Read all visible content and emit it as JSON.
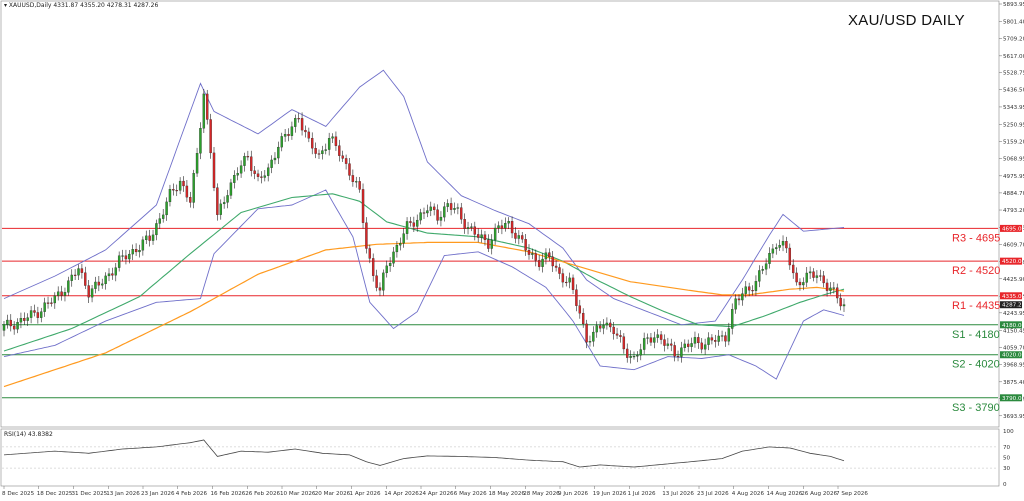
{
  "header": {
    "symbol_line": "XAUUSD,Daily  4331.87 4355.20 4278.31 4287.26",
    "title": "XAU/USD DAILY",
    "rsi_label": "RSI(14) 43.8382"
  },
  "colors": {
    "candle_up": "#2ca02c",
    "candle_down": "#d62728",
    "wick": "#222222",
    "bollinger": "#6f6fc9",
    "ma_green": "#3fa96b",
    "ma_orange": "#ff9a1f",
    "resistance": "#e8262b",
    "support": "#2b8a3e",
    "rsi_line": "#444444"
  },
  "chart_data": {
    "type": "candlestick",
    "title": "XAU/USD DAILY",
    "ylim": [
      3650,
      5893.95
    ],
    "y_ticks": [
      "5893.95",
      "5801.40",
      "5709.20",
      "5617.00",
      "5528.75",
      "5436.50",
      "5343.95",
      "5250.95",
      "5159.20",
      "5068.95",
      "4975.95",
      "4884.70",
      "4793.20",
      "4700.65",
      "4609.70",
      "4516.60",
      "4425.90",
      "4333.05",
      "4243.95",
      "4150.45",
      "4059.70",
      "3968.95",
      "3875.40",
      "3786.20",
      "3693.95"
    ],
    "x_ticks": [
      "8 Dec 2025",
      "18 Dec 2025",
      "31 Dec 2025",
      "13 Jan 2026",
      "23 Jan 2026",
      "4 Feb 2026",
      "16 Feb 2026",
      "26 Feb 2026",
      "10 Mar 2026",
      "20 Mar 2026",
      "1 Apr 2026",
      "14 Apr 2026",
      "24 Apr 2026",
      "6 May 2026",
      "18 May 2026",
      "28 May 2026",
      "9 Jun 2026",
      "19 Jun 2026",
      "1 Jul 2026",
      "13 Jul 2026",
      "23 Jul 2026",
      "4 Aug 2026",
      "14 Aug 2026",
      "26 Aug 2026",
      "7 Sep 2026"
    ],
    "current_price": "4287.26",
    "price_tags": [
      "4695.00",
      "4520.00",
      "4335.00",
      "4180.00",
      "4020.00",
      "3790.00"
    ],
    "levels": [
      {
        "label": "R3 - 4695",
        "value": 4695,
        "kind": "resistance"
      },
      {
        "label": "R2 - 4520",
        "value": 4520,
        "kind": "resistance"
      },
      {
        "label": "R1 - 4435",
        "value": 4335,
        "kind": "resistance"
      },
      {
        "label": "S1 - 4180",
        "value": 4180,
        "kind": "support"
      },
      {
        "label": "S2 - 4020",
        "value": 4020,
        "kind": "support"
      },
      {
        "label": "S3 - 3790",
        "value": 3790,
        "kind": "support"
      }
    ],
    "close_path": [
      [
        0,
        4170
      ],
      [
        5,
        4200
      ],
      [
        10,
        4250
      ],
      [
        15,
        4320
      ],
      [
        19,
        4400
      ],
      [
        22,
        4480
      ],
      [
        25,
        4360
      ],
      [
        28,
        4390
      ],
      [
        31,
        4450
      ],
      [
        34,
        4520
      ],
      [
        37,
        4560
      ],
      [
        40,
        4600
      ],
      [
        43,
        4640
      ],
      [
        46,
        4750
      ],
      [
        49,
        4870
      ],
      [
        52,
        4950
      ],
      [
        55,
        4840
      ],
      [
        57,
        5080
      ],
      [
        59,
        5430
      ],
      [
        61,
        5100
      ],
      [
        63,
        4750
      ],
      [
        66,
        4900
      ],
      [
        69,
        5000
      ],
      [
        72,
        5080
      ],
      [
        75,
        4950
      ],
      [
        78,
        5000
      ],
      [
        81,
        5150
      ],
      [
        84,
        5200
      ],
      [
        87,
        5300
      ],
      [
        90,
        5150
      ],
      [
        93,
        5080
      ],
      [
        96,
        5180
      ],
      [
        99,
        5100
      ],
      [
        102,
        5000
      ],
      [
        105,
        4880
      ],
      [
        107,
        4600
      ],
      [
        109,
        4450
      ],
      [
        111,
        4350
      ],
      [
        113,
        4500
      ],
      [
        116,
        4600
      ],
      [
        119,
        4700
      ],
      [
        122,
        4750
      ],
      [
        125,
        4800
      ],
      [
        128,
        4760
      ],
      [
        131,
        4820
      ],
      [
        134,
        4780
      ],
      [
        137,
        4700
      ],
      [
        140,
        4650
      ],
      [
        143,
        4620
      ],
      [
        146,
        4700
      ],
      [
        149,
        4720
      ],
      [
        152,
        4640
      ],
      [
        155,
        4560
      ],
      [
        158,
        4520
      ],
      [
        161,
        4540
      ],
      [
        164,
        4450
      ],
      [
        167,
        4400
      ],
      [
        170,
        4250
      ],
      [
        172,
        4100
      ],
      [
        174,
        4120
      ],
      [
        177,
        4200
      ],
      [
        180,
        4150
      ],
      [
        183,
        4050
      ],
      [
        186,
        4000
      ],
      [
        189,
        4080
      ],
      [
        192,
        4130
      ],
      [
        195,
        4080
      ],
      [
        198,
        4030
      ],
      [
        201,
        4060
      ],
      [
        204,
        4090
      ],
      [
        207,
        4080
      ],
      [
        210,
        4100
      ],
      [
        213,
        4120
      ],
      [
        216,
        4300
      ],
      [
        219,
        4370
      ],
      [
        222,
        4400
      ],
      [
        225,
        4520
      ],
      [
        228,
        4620
      ],
      [
        231,
        4580
      ],
      [
        234,
        4400
      ],
      [
        237,
        4430
      ],
      [
        240,
        4460
      ],
      [
        243,
        4380
      ],
      [
        246,
        4330
      ],
      [
        248,
        4287
      ]
    ],
    "max_index": 248,
    "bollinger_upper": [
      [
        0,
        4320
      ],
      [
        15,
        4440
      ],
      [
        30,
        4580
      ],
      [
        45,
        4820
      ],
      [
        58,
        5470
      ],
      [
        62,
        5320
      ],
      [
        75,
        5200
      ],
      [
        85,
        5330
      ],
      [
        95,
        5240
      ],
      [
        105,
        5450
      ],
      [
        112,
        5540
      ],
      [
        118,
        5400
      ],
      [
        125,
        5050
      ],
      [
        135,
        4870
      ],
      [
        145,
        4790
      ],
      [
        155,
        4720
      ],
      [
        165,
        4590
      ],
      [
        172,
        4420
      ],
      [
        180,
        4320
      ],
      [
        190,
        4250
      ],
      [
        200,
        4180
      ],
      [
        210,
        4200
      ],
      [
        218,
        4420
      ],
      [
        226,
        4660
      ],
      [
        230,
        4770
      ],
      [
        236,
        4680
      ],
      [
        248,
        4700
      ]
    ],
    "bollinger_lower": [
      [
        0,
        4010
      ],
      [
        15,
        4070
      ],
      [
        30,
        4200
      ],
      [
        45,
        4300
      ],
      [
        58,
        4320
      ],
      [
        62,
        4560
      ],
      [
        75,
        4800
      ],
      [
        85,
        4820
      ],
      [
        95,
        4900
      ],
      [
        103,
        4650
      ],
      [
        108,
        4300
      ],
      [
        115,
        4160
      ],
      [
        122,
        4250
      ],
      [
        130,
        4550
      ],
      [
        140,
        4570
      ],
      [
        150,
        4490
      ],
      [
        160,
        4380
      ],
      [
        168,
        4200
      ],
      [
        176,
        3960
      ],
      [
        186,
        3940
      ],
      [
        196,
        4010
      ],
      [
        206,
        4000
      ],
      [
        214,
        4020
      ],
      [
        222,
        3960
      ],
      [
        228,
        3890
      ],
      [
        236,
        4200
      ],
      [
        242,
        4260
      ],
      [
        248,
        4230
      ]
    ],
    "ma_green": [
      [
        0,
        4040
      ],
      [
        20,
        4160
      ],
      [
        40,
        4330
      ],
      [
        55,
        4560
      ],
      [
        70,
        4780
      ],
      [
        85,
        4860
      ],
      [
        97,
        4880
      ],
      [
        105,
        4840
      ],
      [
        113,
        4730
      ],
      [
        125,
        4670
      ],
      [
        140,
        4650
      ],
      [
        155,
        4590
      ],
      [
        165,
        4520
      ],
      [
        175,
        4420
      ],
      [
        185,
        4330
      ],
      [
        195,
        4250
      ],
      [
        205,
        4180
      ],
      [
        215,
        4170
      ],
      [
        225,
        4230
      ],
      [
        235,
        4300
      ],
      [
        242,
        4340
      ],
      [
        248,
        4370
      ]
    ],
    "ma_orange": [
      [
        0,
        3850
      ],
      [
        30,
        4030
      ],
      [
        55,
        4250
      ],
      [
        75,
        4450
      ],
      [
        95,
        4580
      ],
      [
        110,
        4610
      ],
      [
        125,
        4620
      ],
      [
        140,
        4620
      ],
      [
        155,
        4570
      ],
      [
        170,
        4490
      ],
      [
        185,
        4410
      ],
      [
        200,
        4370
      ],
      [
        212,
        4340
      ],
      [
        220,
        4340
      ],
      [
        232,
        4370
      ],
      [
        240,
        4380
      ],
      [
        248,
        4360
      ]
    ],
    "rsi": {
      "label": "RSI(14) 43.8382",
      "ylim": [
        0,
        100
      ],
      "ticks": [
        "100",
        "70",
        "50",
        "30",
        "0"
      ],
      "values": [
        [
          0,
          55
        ],
        [
          15,
          62
        ],
        [
          25,
          58
        ],
        [
          35,
          66
        ],
        [
          45,
          70
        ],
        [
          55,
          78
        ],
        [
          59,
          83
        ],
        [
          63,
          52
        ],
        [
          70,
          62
        ],
        [
          78,
          60
        ],
        [
          86,
          66
        ],
        [
          94,
          58
        ],
        [
          102,
          55
        ],
        [
          107,
          42
        ],
        [
          111,
          35
        ],
        [
          118,
          48
        ],
        [
          125,
          53
        ],
        [
          135,
          52
        ],
        [
          145,
          50
        ],
        [
          155,
          45
        ],
        [
          165,
          42
        ],
        [
          170,
          32
        ],
        [
          176,
          36
        ],
        [
          186,
          32
        ],
        [
          196,
          38
        ],
        [
          206,
          44
        ],
        [
          212,
          48
        ],
        [
          218,
          62
        ],
        [
          226,
          70
        ],
        [
          232,
          68
        ],
        [
          238,
          58
        ],
        [
          244,
          52
        ],
        [
          248,
          44
        ]
      ]
    }
  }
}
